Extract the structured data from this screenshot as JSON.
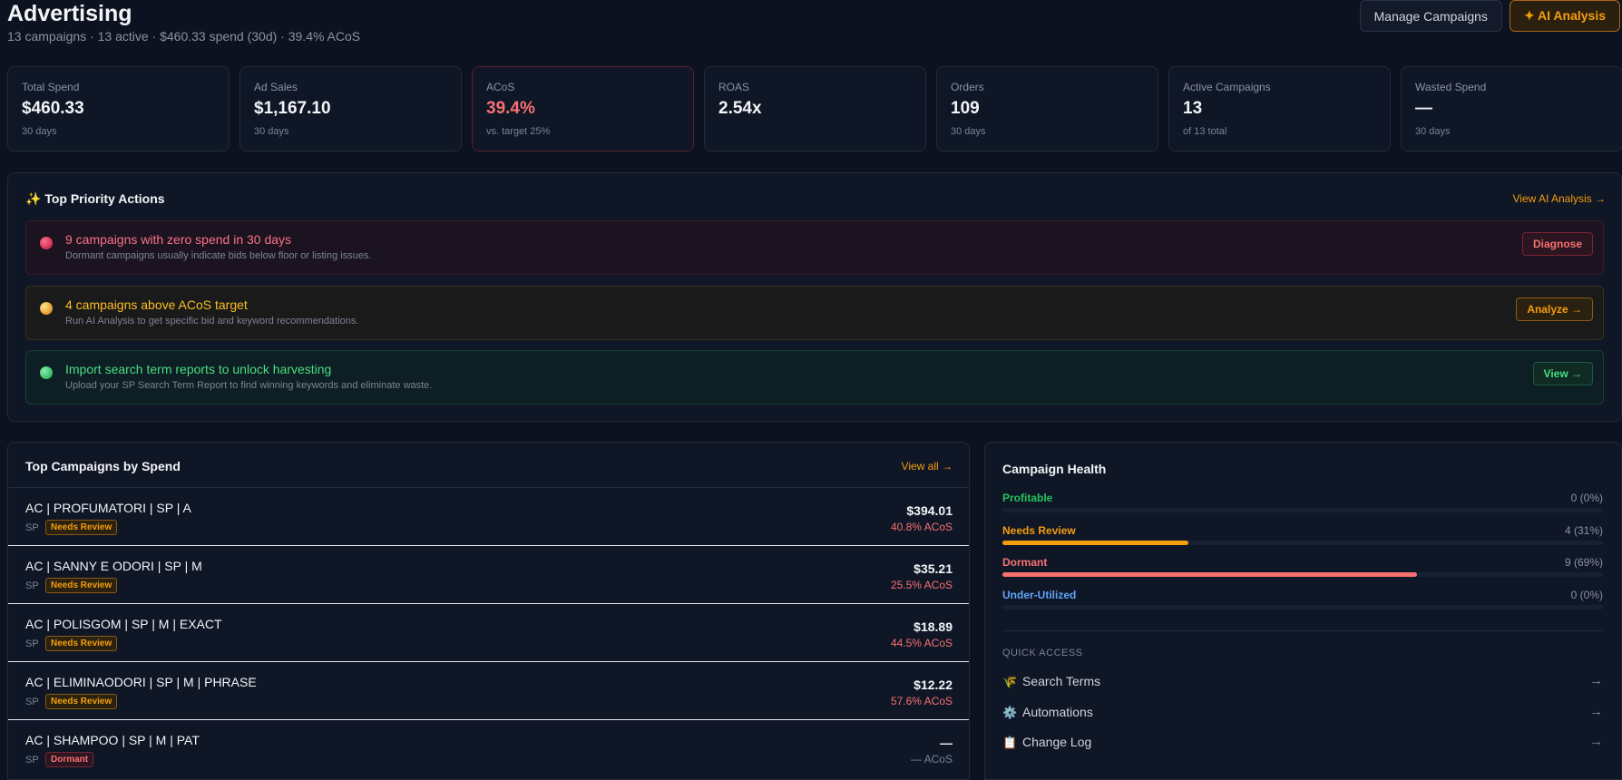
{
  "header": {
    "title": "Advertising",
    "subtitle": "13 campaigns · 13 active · $460.33 spend (30d) · 39.4% ACoS",
    "manage_button": "Manage Campaigns",
    "ai_button": "✦ AI Analysis"
  },
  "kpis": [
    {
      "label": "Total Spend",
      "value": "$460.33",
      "sub": "30 days"
    },
    {
      "label": "Ad Sales",
      "value": "$1,167.10",
      "sub": "30 days"
    },
    {
      "label": "ACoS",
      "value": "39.4%",
      "sub": "vs. target 25%"
    },
    {
      "label": "ROAS",
      "value": "2.54x",
      "sub": ""
    },
    {
      "label": "Orders",
      "value": "109",
      "sub": "30 days"
    },
    {
      "label": "Active Campaigns",
      "value": "13",
      "sub": "of 13 total"
    },
    {
      "label": "Wasted Spend",
      "value": "—",
      "sub": "30 days"
    }
  ],
  "priority": {
    "title": "✨ Top Priority Actions",
    "link": "View AI Analysis →",
    "actions": [
      {
        "title": "9 campaigns with zero spend in 30 days",
        "desc": "Dormant campaigns usually indicate bids below floor or listing issues.",
        "button": "Diagnose"
      },
      {
        "title": "4 campaigns above ACoS target",
        "desc": "Run AI Analysis to get specific bid and keyword recommendations.",
        "button": "Analyze →"
      },
      {
        "title": "Import search term reports to unlock harvesting",
        "desc": "Upload your SP Search Term Report to find winning keywords and eliminate waste.",
        "button": "View →"
      }
    ]
  },
  "top_campaigns": {
    "title": "Top Campaigns by Spend",
    "link": "View all →",
    "rows": [
      {
        "name": "AC | PROFUMATORI | SP | A",
        "type": "SP",
        "badge": "Needs Review",
        "spend": "$394.01",
        "acos": "40.8% ACoS"
      },
      {
        "name": "AC | SANNY E ODORI | SP | M",
        "type": "SP",
        "badge": "Needs Review",
        "spend": "$35.21",
        "acos": "25.5% ACoS"
      },
      {
        "name": "AC | POLISGOM | SP | M | EXACT",
        "type": "SP",
        "badge": "Needs Review",
        "spend": "$18.89",
        "acos": "44.5% ACoS"
      },
      {
        "name": "AC | ELIMINAODORI | SP | M | PHRASE",
        "type": "SP",
        "badge": "Needs Review",
        "spend": "$12.22",
        "acos": "57.6% ACoS"
      },
      {
        "name": "AC | SHAMPOO | SP | M | PAT",
        "type": "SP",
        "badge": "Dormant",
        "spend": "—",
        "acos": "— ACoS"
      }
    ]
  },
  "health": {
    "title": "Campaign Health",
    "rows": [
      {
        "label": "Profitable",
        "value": "0 (0%)",
        "fraction": 0,
        "color": "#22c55e"
      },
      {
        "label": "Needs Review",
        "value": "4 (31%)",
        "fraction": 0.31,
        "color": "#f59e0b"
      },
      {
        "label": "Dormant",
        "value": "9 (69%)",
        "fraction": 0.69,
        "color": "#f87171"
      },
      {
        "label": "Under-Utilized",
        "value": "0 (0%)",
        "fraction": 0,
        "color": "#60a5fa"
      }
    ],
    "quick_access_label": "QUICK ACCESS",
    "quick_access": [
      {
        "icon": "🌾",
        "label": "Search Terms",
        "arrow": "→"
      },
      {
        "icon": "⚙️",
        "label": "Automations",
        "arrow": "→"
      },
      {
        "icon": "📋",
        "label": "Change Log",
        "arrow": "→"
      }
    ]
  }
}
